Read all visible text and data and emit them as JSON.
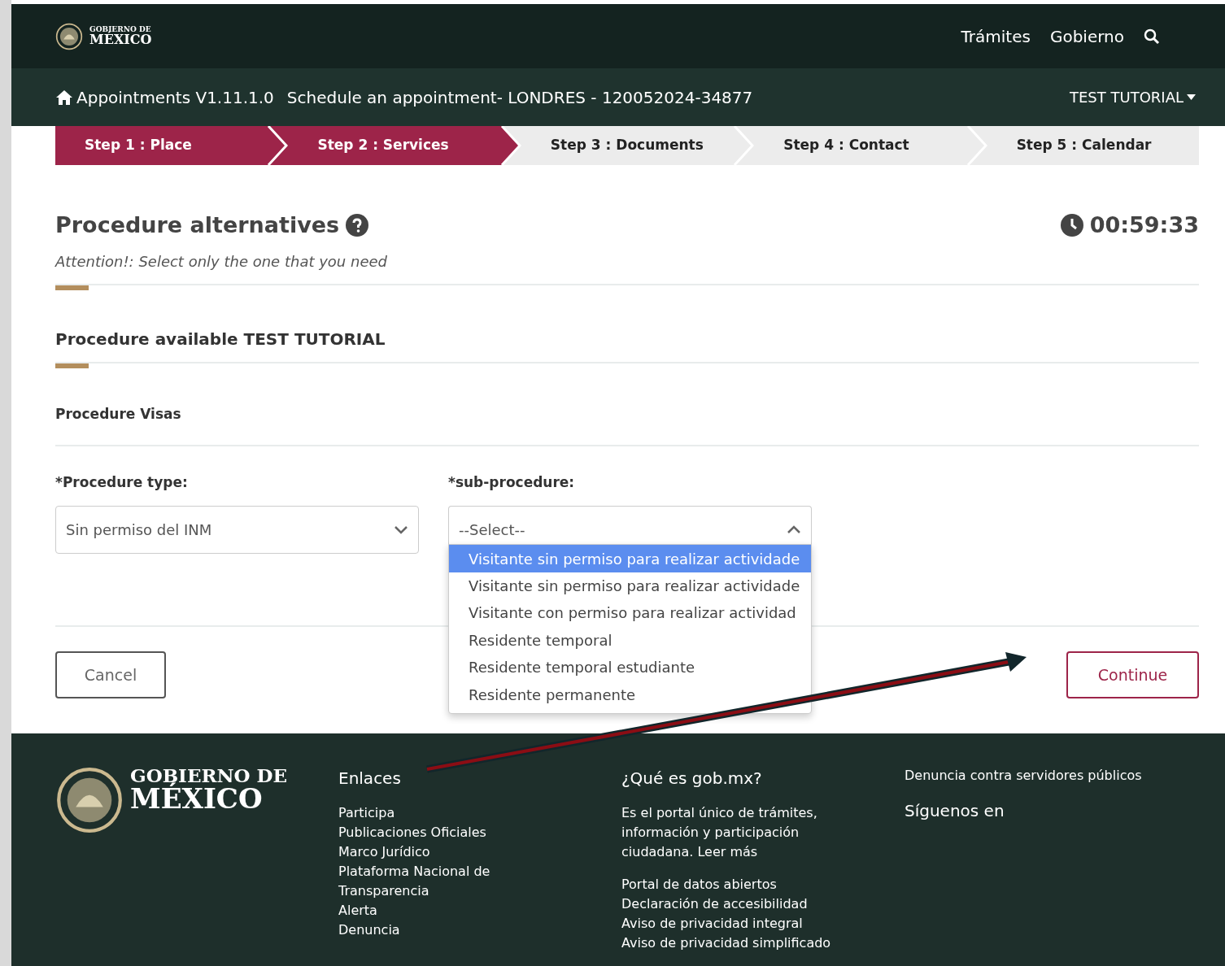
{
  "header": {
    "logo_top": "GOBIERNO DE",
    "logo_bottom": "MÉXICO",
    "links": [
      "Trámites",
      "Gobierno"
    ]
  },
  "breadcrumb": {
    "app": "Appointments V1.11.1.0",
    "title": "Schedule an appointment- LONDRES - 120052024-34877",
    "user": "TEST TUTORIAL"
  },
  "steps": [
    {
      "label": "Step 1 : Place",
      "completed": true
    },
    {
      "label": "Step 2 : Services",
      "completed": true
    },
    {
      "label": "Step 3 : Documents",
      "completed": false
    },
    {
      "label": "Step 4 : Contact",
      "completed": false
    },
    {
      "label": "Step 5 : Calendar",
      "completed": false
    }
  ],
  "page": {
    "title": "Procedure alternatives",
    "timer": "00:59:33",
    "notice": "Attention!: Select only the one that you need",
    "section": "Procedure available TEST TUTORIAL",
    "subsection": "Procedure Visas"
  },
  "fields": [
    {
      "label": "*Procedure type:",
      "value": "Sin permiso del INM",
      "expanded": false
    },
    {
      "label": "*sub-procedure:",
      "value": "--Select--",
      "expanded": true,
      "options": [
        {
          "label": "Visitante sin permiso para realizar actividade",
          "selected": true
        },
        {
          "label": "Visitante sin permiso para realizar actividade",
          "selected": false
        },
        {
          "label": "Visitante con permiso para realizar actividad",
          "selected": false
        },
        {
          "label": "Residente temporal",
          "selected": false
        },
        {
          "label": "Residente temporal estudiante",
          "selected": false
        },
        {
          "label": "Residente permanente",
          "selected": false
        }
      ]
    }
  ],
  "buttons": [
    {
      "label": "Cancel",
      "kind": "secondary"
    },
    {
      "label": "Continue",
      "kind": "primary"
    }
  ],
  "footer": {
    "logo_top": "GOBIERNO DE",
    "logo_bottom": "MÉXICO",
    "links_title": "Enlaces",
    "links": [
      "Participa",
      "Publicaciones Oficiales",
      "Marco Jurídico",
      "Plataforma Nacional de Transparencia",
      "Alerta",
      "Denuncia"
    ],
    "about_title": "¿Qué es gob.mx?",
    "about_text": "Es el portal único de trámites, información y participación ciudadana.",
    "about_link": "Leer más",
    "about_links": [
      "Portal de datos abiertos",
      "Declaración de accesibilidad",
      "Aviso de privacidad integral",
      "Aviso de privacidad simplificado"
    ],
    "report": "Denuncia contra servidores públicos",
    "follow": "Síguenos en"
  }
}
